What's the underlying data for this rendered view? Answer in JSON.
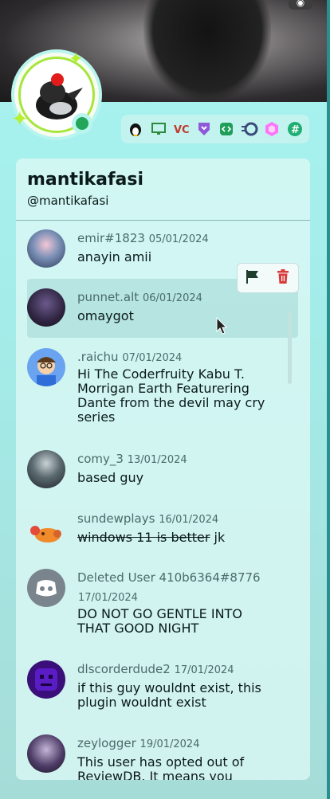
{
  "profile": {
    "display_name": "mantikafasi",
    "username": "@mantikafasi",
    "status_color": "#23a55a",
    "accent_color": "#a6e63c",
    "banner_badge_icon": "nitro-icon",
    "badges": [
      "linux-penguin-icon",
      "monitor-icon",
      "vc-icon",
      "shield-icon",
      "code-icon",
      "speed-icon",
      "hexagon-icon",
      "hashtag-icon"
    ]
  },
  "action_bar": {
    "icons": [
      "report-flag-icon",
      "delete-trash-icon"
    ]
  },
  "reviews": [
    {
      "author": "emir#1823",
      "date": "05/01/2024",
      "text": "anayin amii"
    },
    {
      "author": "punnet.alt",
      "date": "06/01/2024",
      "text": "omaygot"
    },
    {
      "author": ".raichu",
      "date": "07/01/2024",
      "text": "Hi The Coderfruity Kabu T. Morrigan Earth Featurering Dante from the devil may cry series"
    },
    {
      "author": "comy_3",
      "date": "13/01/2024",
      "text": "based guy"
    },
    {
      "author": "sundewplays",
      "date": "16/01/2024",
      "text_struck": "windows 11 is better",
      "text": " jk"
    },
    {
      "author": "Deleted User 410b6364#8776",
      "date": "17/01/2024",
      "text": "DO NOT GO GENTLE INTO THAT GOOD NIGHT"
    },
    {
      "author": "dlscorderdude2",
      "date": "17/01/2024",
      "text": "if this guy wouldnt exist, this plugin wouldnt exist"
    },
    {
      "author": "zeylogger",
      "date": "19/01/2024",
      "text": "This user has opted out of ReviewDB. It means you cannot"
    }
  ]
}
